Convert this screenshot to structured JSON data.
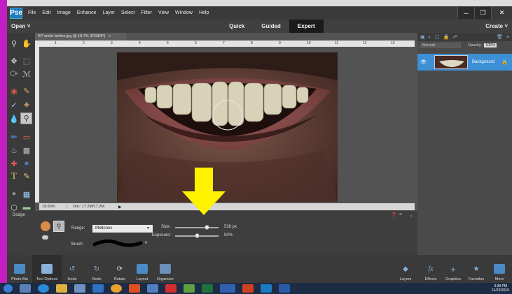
{
  "menu": {
    "app_icon": "Pse",
    "items": [
      "File",
      "Edit",
      "Image",
      "Enhance",
      "Layer",
      "Select",
      "Filter",
      "View",
      "Window",
      "Help"
    ],
    "window_controls": [
      "minimize-icon",
      "restore-icon",
      "close-icon"
    ]
  },
  "modebar": {
    "open_label": "Open",
    "modes": [
      "Quick",
      "Guided",
      "Expert"
    ],
    "active_mode": "Expert",
    "create_label": "Create"
  },
  "document": {
    "tab_title": "KP-smile-before.jpg @ 19.7% (RGB/8*)",
    "zoom": "19.65%",
    "doc_size": "Doc: 17.2M/17.2M",
    "ruler_marks": [
      "1",
      "2",
      "3",
      "4",
      "5",
      "6",
      "7",
      "8",
      "9",
      "10",
      "11",
      "12",
      "13"
    ]
  },
  "layers": {
    "blend_mode": "Normal",
    "opacity_label": "Opacity:",
    "opacity_value": "100%",
    "layer_name": "Background"
  },
  "tool_options": {
    "tool_name": "Dodge",
    "range_label": "Range:",
    "range_value": "Midtones",
    "brush_label": "Brush:",
    "size_label": "Size:",
    "size_value": "528 px",
    "size_level": 0.72,
    "exposure_label": "Exposure:",
    "exposure_value": "50%",
    "exposure_level": 0.5
  },
  "bottom_bar": {
    "left": [
      "Photo Bin",
      "Tool Options",
      "Undo",
      "Redo",
      "Rotate",
      "Layout",
      "Organizer"
    ],
    "right": [
      "Layers",
      "Effects",
      "Graphics",
      "Favorites",
      "More"
    ]
  },
  "clock": {
    "time": "3:38 PM",
    "date": "11/22/2015"
  },
  "colors": {
    "foreground": "#ee1111",
    "background": "#ffffff",
    "accent": "#3d8fd6",
    "arrow": "#fff200"
  }
}
